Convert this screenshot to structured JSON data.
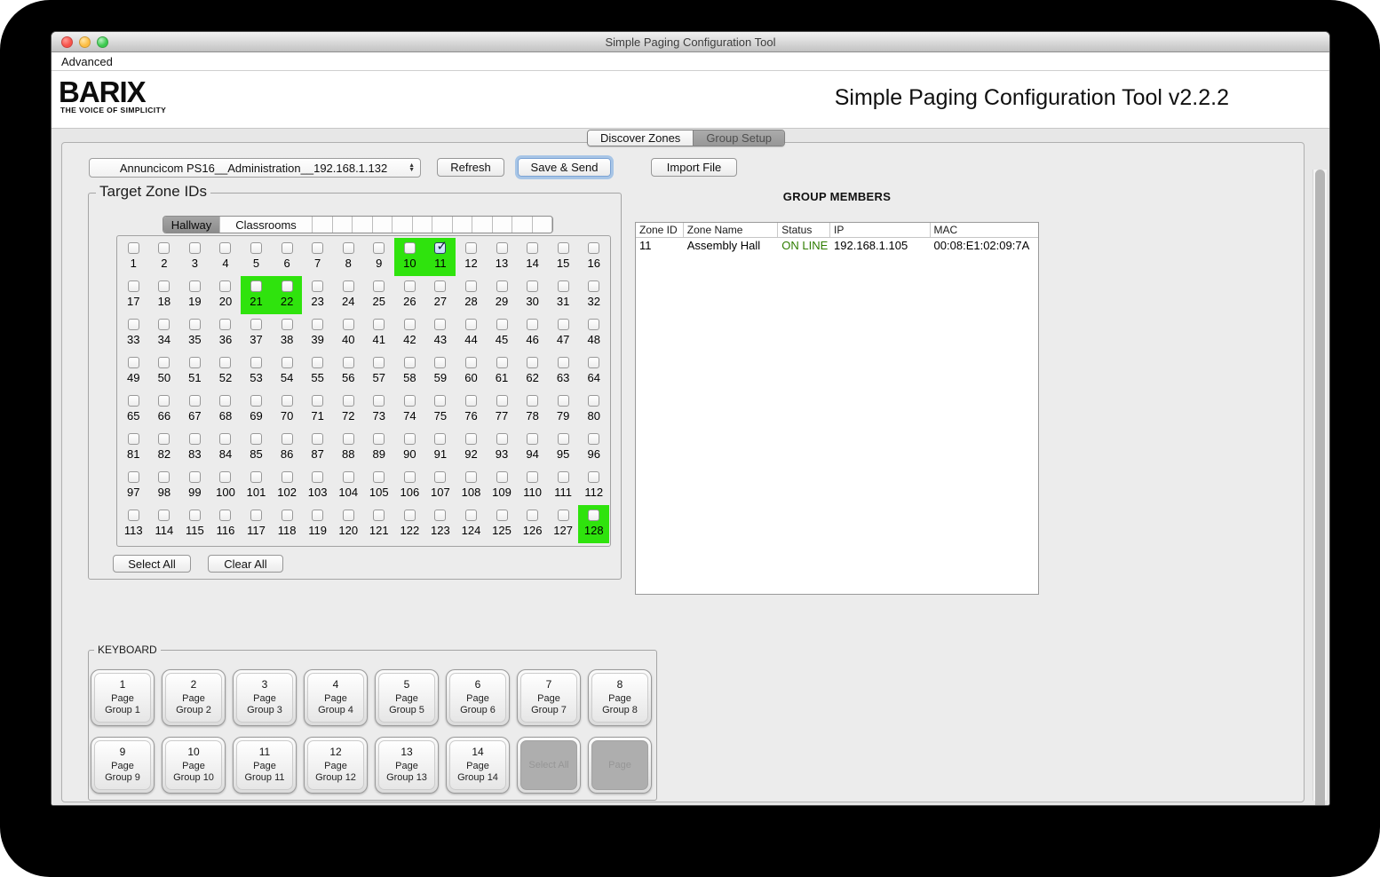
{
  "window": {
    "title": "Simple Paging Configuration Tool",
    "menu": [
      "Advanced"
    ],
    "logo": {
      "text": "BARIX",
      "tagline": "THE VOICE OF SIMPLICITY"
    },
    "app_title": "Simple Paging Configuration Tool v2.2.2"
  },
  "tabs": [
    {
      "label": "Discover Zones",
      "selected": false
    },
    {
      "label": "Group Setup",
      "selected": true
    }
  ],
  "toolbar": {
    "device_select": "Annuncicom PS16__Administration__192.168.1.132",
    "refresh_label": "Refresh",
    "save_send_label": "Save & Send",
    "import_label": "Import File"
  },
  "target_zones": {
    "group_label": "Target Zone IDs",
    "page_tabs": [
      {
        "label": "Hallway",
        "selected": true
      },
      {
        "label": "Classrooms",
        "selected": false
      }
    ],
    "empty_page_tabs": 12,
    "zone_count": 128,
    "columns": 16,
    "highlighted": [
      10,
      11,
      21,
      22,
      128
    ],
    "checked": [
      11
    ],
    "select_all_label": "Select All",
    "clear_all_label": "Clear All"
  },
  "group_members": {
    "title": "GROUP MEMBERS",
    "columns": [
      "Zone ID",
      "Zone Name",
      "Status",
      "IP",
      "MAC"
    ],
    "rows": [
      {
        "zone_id": "11",
        "zone_name": "Assembly Hall",
        "status": "ON LINE",
        "ip": "192.168.1.105",
        "mac": "00:08:E1:02:09:7A"
      }
    ],
    "status_online_color": "#2f7d00"
  },
  "keyboard": {
    "group_label": "KEYBOARD",
    "keys": [
      {
        "number": "1",
        "label": "Page Group 1",
        "enabled": true
      },
      {
        "number": "2",
        "label": "Page Group 2",
        "enabled": true
      },
      {
        "number": "3",
        "label": "Page Group 3",
        "enabled": true
      },
      {
        "number": "4",
        "label": "Page Group 4",
        "enabled": true
      },
      {
        "number": "5",
        "label": "Page Group 5",
        "enabled": true
      },
      {
        "number": "6",
        "label": "Page Group 6",
        "enabled": true
      },
      {
        "number": "7",
        "label": "Page Group 7",
        "enabled": true
      },
      {
        "number": "8",
        "label": "Page Group 8",
        "enabled": true
      },
      {
        "number": "9",
        "label": "Page Group 9",
        "enabled": true
      },
      {
        "number": "10",
        "label": "Page Group 10",
        "enabled": true
      },
      {
        "number": "11",
        "label": "Page Group 11",
        "enabled": true
      },
      {
        "number": "12",
        "label": "Page Group 12",
        "enabled": true
      },
      {
        "number": "13",
        "label": "Page Group 13",
        "enabled": true
      },
      {
        "number": "14",
        "label": "Page Group 14",
        "enabled": true
      },
      {
        "number": "",
        "label": "Select All",
        "enabled": false
      },
      {
        "number": "",
        "label": "Page",
        "enabled": false
      }
    ]
  },
  "colors": {
    "highlight_green": "#2fe30d",
    "focus_blue": "#a7c5e6"
  },
  "icons": {
    "stepper_up": "▲",
    "stepper_down": "▼"
  }
}
